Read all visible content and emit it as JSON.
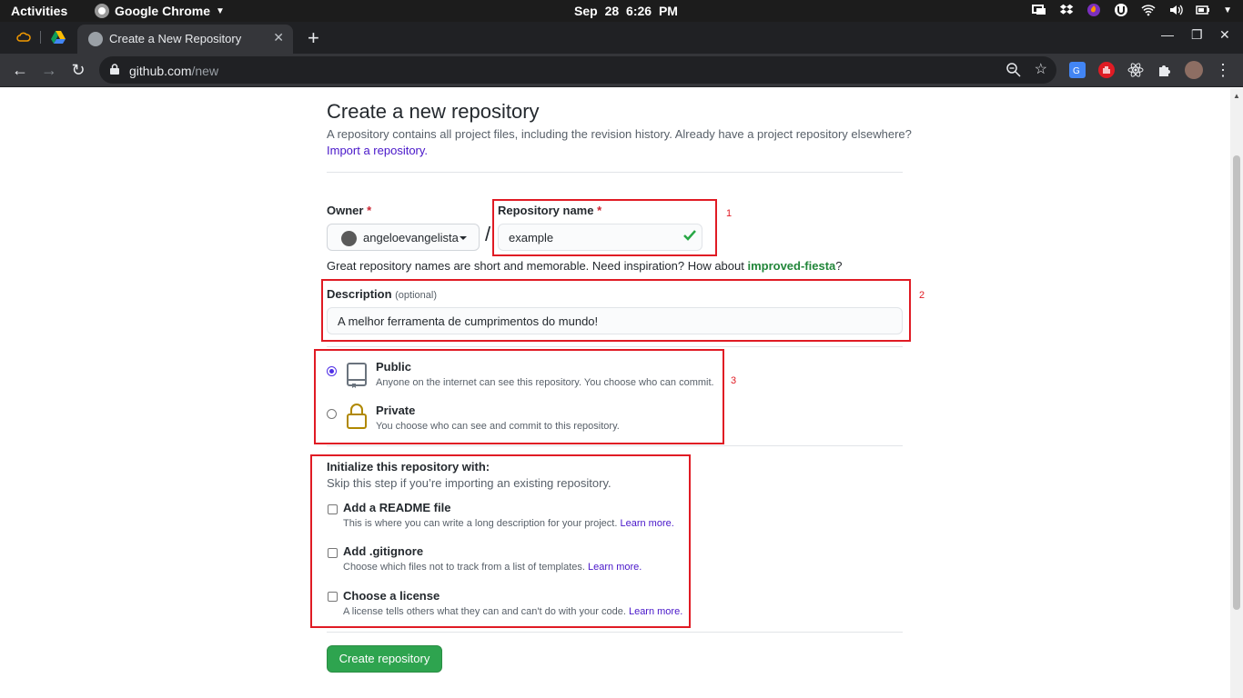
{
  "system": {
    "activities": "Activities",
    "app_name": "Google Chrome",
    "datetime": "Sep 28   6:26 PM"
  },
  "browser": {
    "tab_title": "Create a New Repository",
    "url_host": "github.com",
    "url_path": "/new"
  },
  "page": {
    "title": "Create a new repository",
    "subtitle": "A repository contains all project files, including the revision history. Already have a project repository elsewhere?",
    "import_link": "Import a repository.",
    "owner_label": "Owner",
    "owner_value": "angeloevangelista",
    "repo_name_label": "Repository name",
    "required_mark": "*",
    "slash": "/",
    "repo_name_value": "example",
    "hint_prefix": "Great repository names are short and memorable. Need inspiration? How about ",
    "hint_suggestion": "improved-fiesta",
    "hint_suffix": "?",
    "description_label": "Description",
    "description_optional": "(optional)",
    "description_value": "A melhor ferramenta de cumprimentos do mundo!",
    "visibility": {
      "public_title": "Public",
      "public_desc": "Anyone on the internet can see this repository. You choose who can commit.",
      "private_title": "Private",
      "private_desc": "You choose who can see and commit to this repository.",
      "selected": "Public"
    },
    "init": {
      "title": "Initialize this repository with:",
      "subtitle": "Skip this step if you’re importing an existing repository.",
      "readme_title": "Add a README file",
      "readme_desc": "This is where you can write a long description for your project. ",
      "gitignore_title": "Add .gitignore",
      "gitignore_desc": "Choose which files not to track from a list of templates. ",
      "license_title": "Choose a license",
      "license_desc": "A license tells others what they can and can't do with your code. ",
      "learn_more": "Learn more."
    },
    "create_button": "Create repository"
  },
  "annotations": {
    "box1": "1",
    "box2": "2",
    "box3": "3",
    "color": "#e01b24"
  },
  "colors": {
    "primary_button": "#2ea44f",
    "link": "#4816c9",
    "suggestion": "#22863a"
  }
}
